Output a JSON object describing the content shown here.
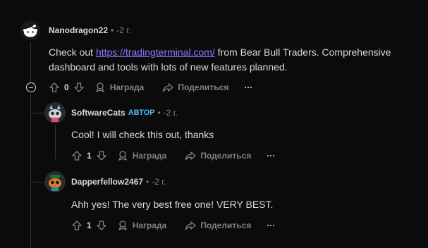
{
  "comments": [
    {
      "username": "Nanodragon22",
      "time": "-2 г.",
      "text_before": "Check out ",
      "link_text": "https://tradingterminal.com/",
      "text_after": " from Bear Bull Traders. Comprehensive dashboard and tools with lots of new features planned.",
      "votes": "0",
      "award_label": "Награда",
      "share_label": "Поделиться",
      "more_label": "···"
    },
    {
      "username": "SoftwareCats",
      "badge": "АВТОР",
      "time": "-2 г.",
      "text": "Cool! I will check this out, thanks",
      "votes": "1",
      "award_label": "Награда",
      "share_label": "Поделиться",
      "more_label": "···"
    },
    {
      "username": "Dapperfellow2467",
      "time": "-2 г.",
      "text": "Ahh yes! The very best free one! VERY BEST.",
      "votes": "1",
      "award_label": "Награда",
      "share_label": "Поделиться",
      "more_label": "···"
    }
  ],
  "colors": {
    "background": "#0b0b0b",
    "link": "#8e7cff",
    "op_badge": "#4fbcff",
    "muted": "#818384"
  }
}
